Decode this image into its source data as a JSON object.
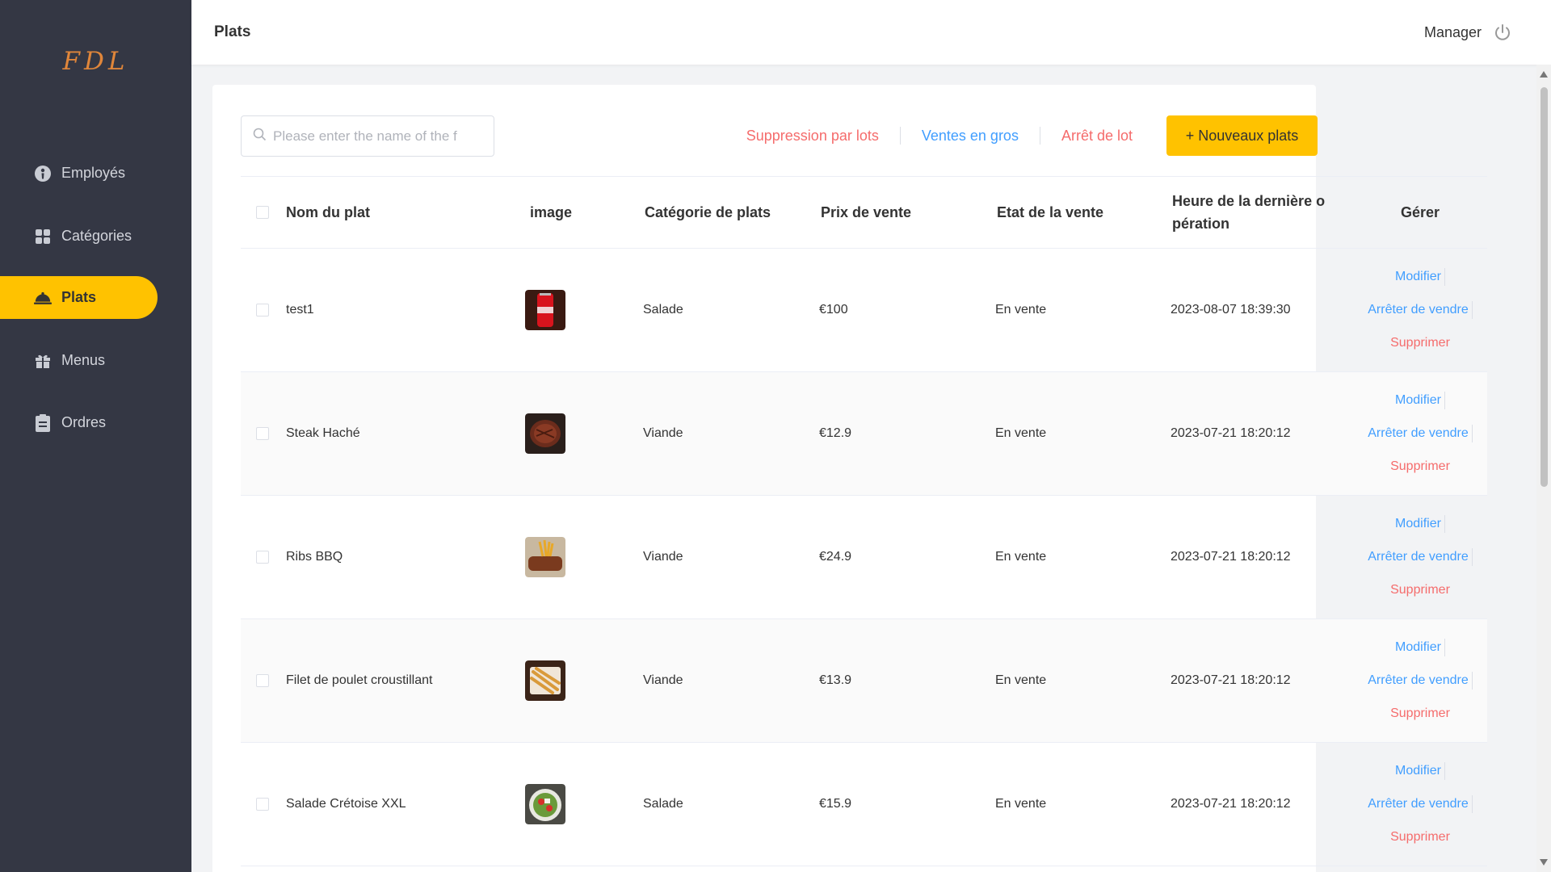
{
  "app": {
    "logo": "FDL",
    "user": "Manager"
  },
  "header": {
    "title": "Plats"
  },
  "sidebar": {
    "items": [
      {
        "label": "Employés",
        "icon": "employee-icon",
        "active": false
      },
      {
        "label": "Catégories",
        "icon": "categories-grid-icon",
        "active": false
      },
      {
        "label": "Plats",
        "icon": "dish-cloche-icon",
        "active": true
      },
      {
        "label": "Menus",
        "icon": "gift-icon",
        "active": false
      },
      {
        "label": "Ordres",
        "icon": "clipboard-icon",
        "active": false
      }
    ]
  },
  "toolbar": {
    "search_placeholder": "Please enter the name of the f",
    "batch_delete": "Suppression par lots",
    "bulk_sale": "Ventes en gros",
    "batch_stop": "Arrêt de lot",
    "new_dish": "+ Nouveaux plats"
  },
  "table": {
    "headers": [
      "Nom du plat",
      "image",
      "Catégorie de plats",
      "Prix de vente",
      "Etat de la vente",
      "Heure de la dernière o pération",
      "Gérer"
    ],
    "rows": [
      {
        "name": "test1",
        "category": "Salade",
        "price": "€100",
        "status": "En vente",
        "updated": "2023-08-07 18:39:30",
        "image": "cola-can"
      },
      {
        "name": "Steak Haché",
        "category": "Viande",
        "price": "€12.9",
        "status": "En vente",
        "updated": "2023-07-21 18:20:12",
        "image": "steak"
      },
      {
        "name": "Ribs BBQ",
        "category": "Viande",
        "price": "€24.9",
        "status": "En vente",
        "updated": "2023-07-21 18:20:12",
        "image": "ribs"
      },
      {
        "name": "Filet de poulet croustillant",
        "category": "Viande",
        "price": "€13.9",
        "status": "En vente",
        "updated": "2023-07-21 18:20:12",
        "image": "chicken"
      },
      {
        "name": "Salade Crétoise XXL",
        "category": "Salade",
        "price": "€15.9",
        "status": "En vente",
        "updated": "2023-07-21 18:20:12",
        "image": "salad"
      }
    ],
    "actions": {
      "edit": "Modifier",
      "stop": "Arrêter de vendre",
      "delete": "Supprimer"
    }
  },
  "colors": {
    "sidebar": "#343744",
    "accent": "#ffc200",
    "link_blue": "#419eff",
    "link_red": "#f56c6c"
  }
}
